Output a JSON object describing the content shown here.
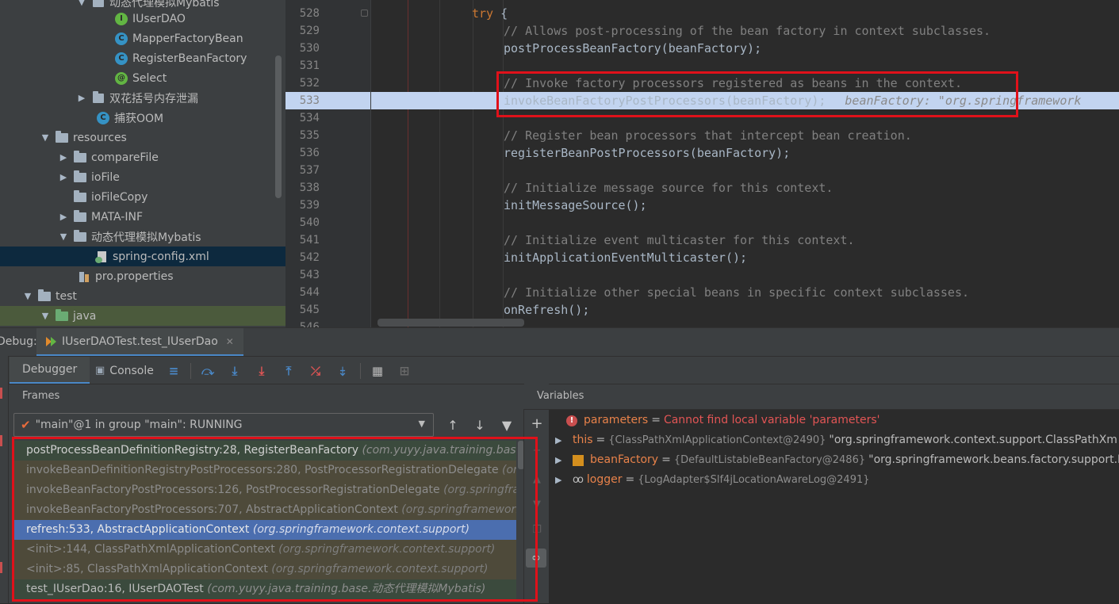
{
  "project_tree": {
    "items": [
      {
        "label": "动态代理模拟Mybatis",
        "type": "package",
        "expanded": true
      },
      {
        "label": "IUserDAO",
        "type": "interface",
        "icon": "interface-icon"
      },
      {
        "label": "MapperFactoryBean",
        "type": "class",
        "icon": "class-icon"
      },
      {
        "label": "RegisterBeanFactory",
        "type": "class",
        "icon": "class-icon"
      },
      {
        "label": "Select",
        "type": "annotation",
        "icon": "annotation-icon"
      },
      {
        "label": "双花括号内存泄漏",
        "type": "package",
        "expanded": false
      },
      {
        "label": "捕获OOM",
        "type": "class",
        "icon": "class-icon"
      },
      {
        "label": "resources",
        "type": "folder",
        "expanded": true
      },
      {
        "label": "compareFile",
        "type": "folder",
        "expanded": false
      },
      {
        "label": "ioFile",
        "type": "folder",
        "expanded": false
      },
      {
        "label": "ioFileCopy",
        "type": "folder",
        "expanded": null
      },
      {
        "label": "MATA-INF",
        "type": "folder",
        "expanded": false
      },
      {
        "label": "动态代理模拟Mybatis",
        "type": "folder",
        "expanded": true
      },
      {
        "label": "spring-config.xml",
        "type": "xml",
        "selected": true
      },
      {
        "label": "pro.properties",
        "type": "properties"
      },
      {
        "label": "test",
        "type": "folder",
        "expanded": true
      },
      {
        "label": "java",
        "type": "source-folder",
        "expanded": true
      }
    ]
  },
  "editor": {
    "lines": [
      {
        "num": "528",
        "indent": 1,
        "code": "try {"
      },
      {
        "num": "529",
        "indent": 2,
        "code": "// Allows post-processing of the bean factory in context subclasses."
      },
      {
        "num": "530",
        "indent": 2,
        "code": "postProcessBeanFactory(beanFactory);"
      },
      {
        "num": "531",
        "indent": 0,
        "code": ""
      },
      {
        "num": "532",
        "indent": 2,
        "code": "// Invoke factory processors registered as beans in the context."
      },
      {
        "num": "533",
        "indent": 2,
        "code": "invokeBeanFactoryPostProcessors(beanFactory);",
        "inline_value": "beanFactory: \"org.springframework",
        "current": true
      },
      {
        "num": "534",
        "indent": 0,
        "code": ""
      },
      {
        "num": "535",
        "indent": 2,
        "code": "// Register bean processors that intercept bean creation."
      },
      {
        "num": "536",
        "indent": 2,
        "code": "registerBeanPostProcessors(beanFactory);"
      },
      {
        "num": "537",
        "indent": 0,
        "code": ""
      },
      {
        "num": "538",
        "indent": 2,
        "code": "// Initialize message source for this context."
      },
      {
        "num": "539",
        "indent": 2,
        "code": "initMessageSource();"
      },
      {
        "num": "540",
        "indent": 0,
        "code": ""
      },
      {
        "num": "541",
        "indent": 2,
        "code": "// Initialize event multicaster for this context."
      },
      {
        "num": "542",
        "indent": 2,
        "code": "initApplicationEventMulticaster();"
      },
      {
        "num": "543",
        "indent": 0,
        "code": ""
      },
      {
        "num": "544",
        "indent": 2,
        "code": "// Initialize other special beans in specific context subclasses."
      },
      {
        "num": "545",
        "indent": 2,
        "code": "onRefresh();"
      },
      {
        "num": "546",
        "indent": 0,
        "code": ""
      }
    ]
  },
  "debug": {
    "label": "Debug:",
    "session_tab": "IUserDAOTest.test_IUserDao",
    "tabs": {
      "debugger": "Debugger",
      "console": "Console"
    },
    "frames_title": "Frames",
    "variables_title": "Variables",
    "thread": "\"main\"@1 in group \"main\": RUNNING",
    "frames": [
      {
        "method": "postProcessBeanDefinitionRegistry:28, RegisterBeanFactory",
        "pkg": "(com.yuyy.java.training.base.动态代",
        "kind": "cur"
      },
      {
        "method": "invokeBeanDefinitionRegistryPostProcessors:280, PostProcessorRegistrationDelegate",
        "pkg": "(org.spri",
        "kind": "lib"
      },
      {
        "method": "invokeBeanFactoryPostProcessors:126, PostProcessorRegistrationDelegate",
        "pkg": "(org.springframewo",
        "kind": "lib"
      },
      {
        "method": "invokeBeanFactoryPostProcessors:707, AbstractApplicationContext",
        "pkg": "(org.springframework.cont",
        "kind": "lib"
      },
      {
        "method": "refresh:533, AbstractApplicationContext",
        "pkg": "(org.springframework.context.support)",
        "kind": "sel"
      },
      {
        "method": "<init>:144, ClassPathXmlApplicationContext",
        "pkg": "(org.springframework.context.support)",
        "kind": "lib"
      },
      {
        "method": "<init>:85, ClassPathXmlApplicationContext",
        "pkg": "(org.springframework.context.support)",
        "kind": "lib"
      },
      {
        "method": "test_IUserDao:16, IUserDAOTest",
        "pkg": "(com.yuyy.java.training.base.动态代理模拟Mybatis)",
        "kind": "user"
      }
    ],
    "variables": [
      {
        "name": "parameters",
        "eq": "=",
        "error": "Cannot find local variable 'parameters'",
        "icon": "error-icon"
      },
      {
        "name": "this",
        "eq": "=",
        "id": "{ClassPathXmlApplicationContext@2490}",
        "value": "\"org.springframework.context.support.ClassPathXm",
        "icon": "none"
      },
      {
        "name": "beanFactory",
        "eq": "=",
        "id": "{DefaultListableBeanFactory@2486}",
        "value": "\"org.springframework.beans.factory.support.Defa",
        "icon": "field-icon"
      },
      {
        "name": "logger",
        "eq": "=",
        "id": "{LogAdapter$Slf4jLocationAwareLog@2491}",
        "value": "",
        "icon": "watch-icon"
      }
    ]
  },
  "colors": {
    "accent": "#4a88c7",
    "highlight_box": "#e0111a",
    "selected_frame": "#4b6eaf",
    "keyword": "#cc7832",
    "comment": "#808080",
    "var_name": "#e8824a",
    "error_text": "#e25555"
  }
}
